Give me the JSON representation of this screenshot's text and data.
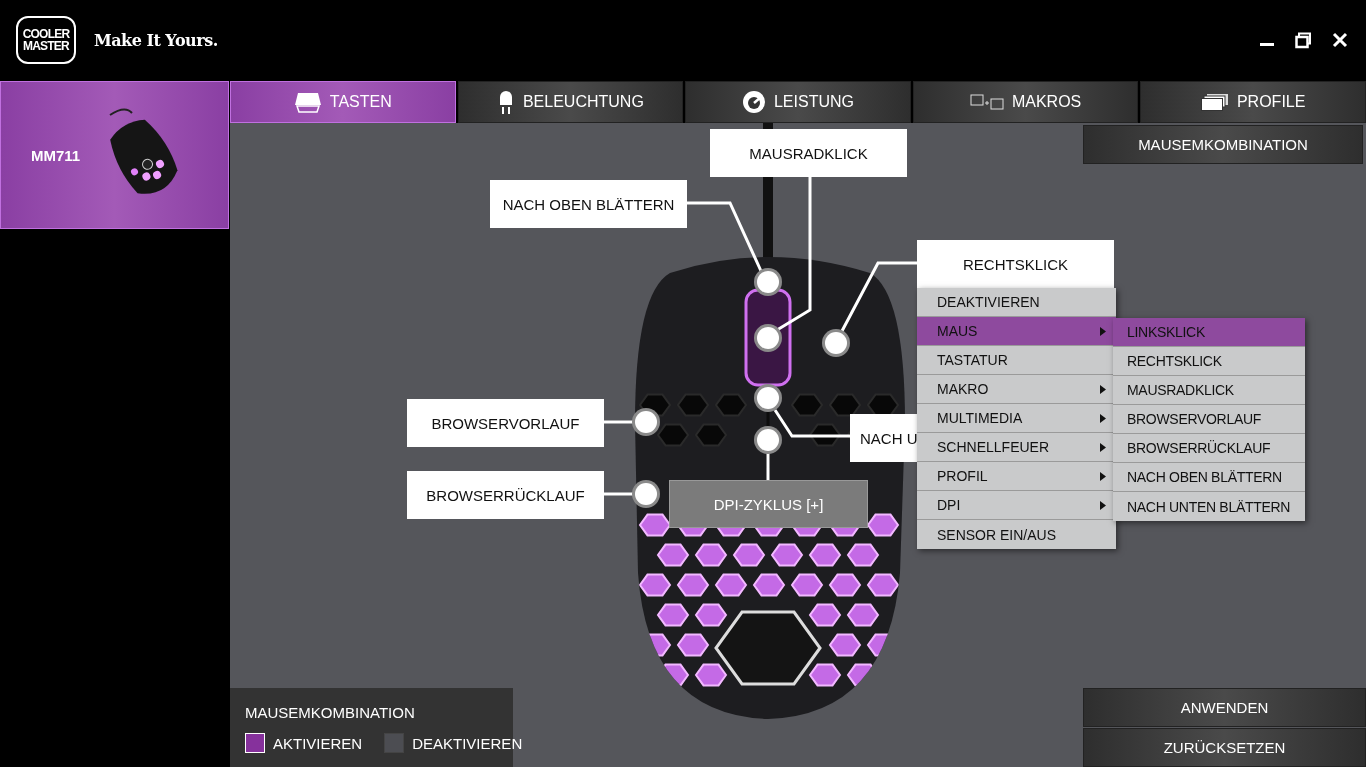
{
  "header": {
    "logo": {
      "line1": "COOLER",
      "line2": "MASTER"
    },
    "tagline": "Make It Yours."
  },
  "devices": [
    {
      "label": "MM711",
      "selected": true
    }
  ],
  "tabs": [
    {
      "label": "TASTEN",
      "selected": true
    },
    {
      "label": "BELEUCHTUNG",
      "selected": false
    },
    {
      "label": "LEISTUNG",
      "selected": false
    },
    {
      "label": "MAKROS",
      "selected": false
    },
    {
      "label": "PROFILE",
      "selected": false
    }
  ],
  "combo_button": "MAUSEMKOMBINATION",
  "callouts": [
    {
      "label": "MAUSRADKLICK",
      "highlighted": false
    },
    {
      "label": "NACH OBEN BLÄTTERN",
      "highlighted": false
    },
    {
      "label": "RECHTSKLICK",
      "highlighted": false
    },
    {
      "label": "BROWSERVORLAUF",
      "highlighted": false
    },
    {
      "label": "BROWSERRÜCKLAUF",
      "highlighted": false
    },
    {
      "label": "NACH U",
      "highlighted": false
    },
    {
      "label": "DPI-ZYKLUS [+]",
      "highlighted": true
    }
  ],
  "menu": [
    {
      "label": "DEAKTIVIEREN",
      "submenu": false,
      "selected": false
    },
    {
      "label": "MAUS",
      "submenu": true,
      "selected": true
    },
    {
      "label": "TASTATUR",
      "submenu": false,
      "selected": false
    },
    {
      "label": "MAKRO",
      "submenu": true,
      "selected": false
    },
    {
      "label": "MULTIMEDIA",
      "submenu": true,
      "selected": false
    },
    {
      "label": "SCHNELLFEUER",
      "submenu": true,
      "selected": false
    },
    {
      "label": "PROFIL",
      "submenu": true,
      "selected": false
    },
    {
      "label": "DPI",
      "submenu": true,
      "selected": false
    },
    {
      "label": "SENSOR EIN/AUS",
      "submenu": false,
      "selected": false
    }
  ],
  "submenu": [
    {
      "label": "LINKSKLICK",
      "selected": true
    },
    {
      "label": "RECHTSKLICK",
      "selected": false
    },
    {
      "label": "MAUSRADKLICK",
      "selected": false
    },
    {
      "label": "BROWSERVORLAUF",
      "selected": false
    },
    {
      "label": "BROWSERRÜCKLAUF",
      "selected": false
    },
    {
      "label": "NACH OBEN BLÄTTERN",
      "selected": false
    },
    {
      "label": "NACH UNTEN BLÄTTERN",
      "selected": false
    }
  ],
  "legend": {
    "title": "MAUSEMKOMBINATION",
    "items": [
      {
        "label": "AKTIVIEREN",
        "color": "#86319c",
        "selected": true
      },
      {
        "label": "DEAKTIVIEREN",
        "color": "#4c4d52",
        "selected": false
      }
    ]
  },
  "actions": [
    "ANWENDEN",
    "ZURÜCKSETZEN"
  ]
}
